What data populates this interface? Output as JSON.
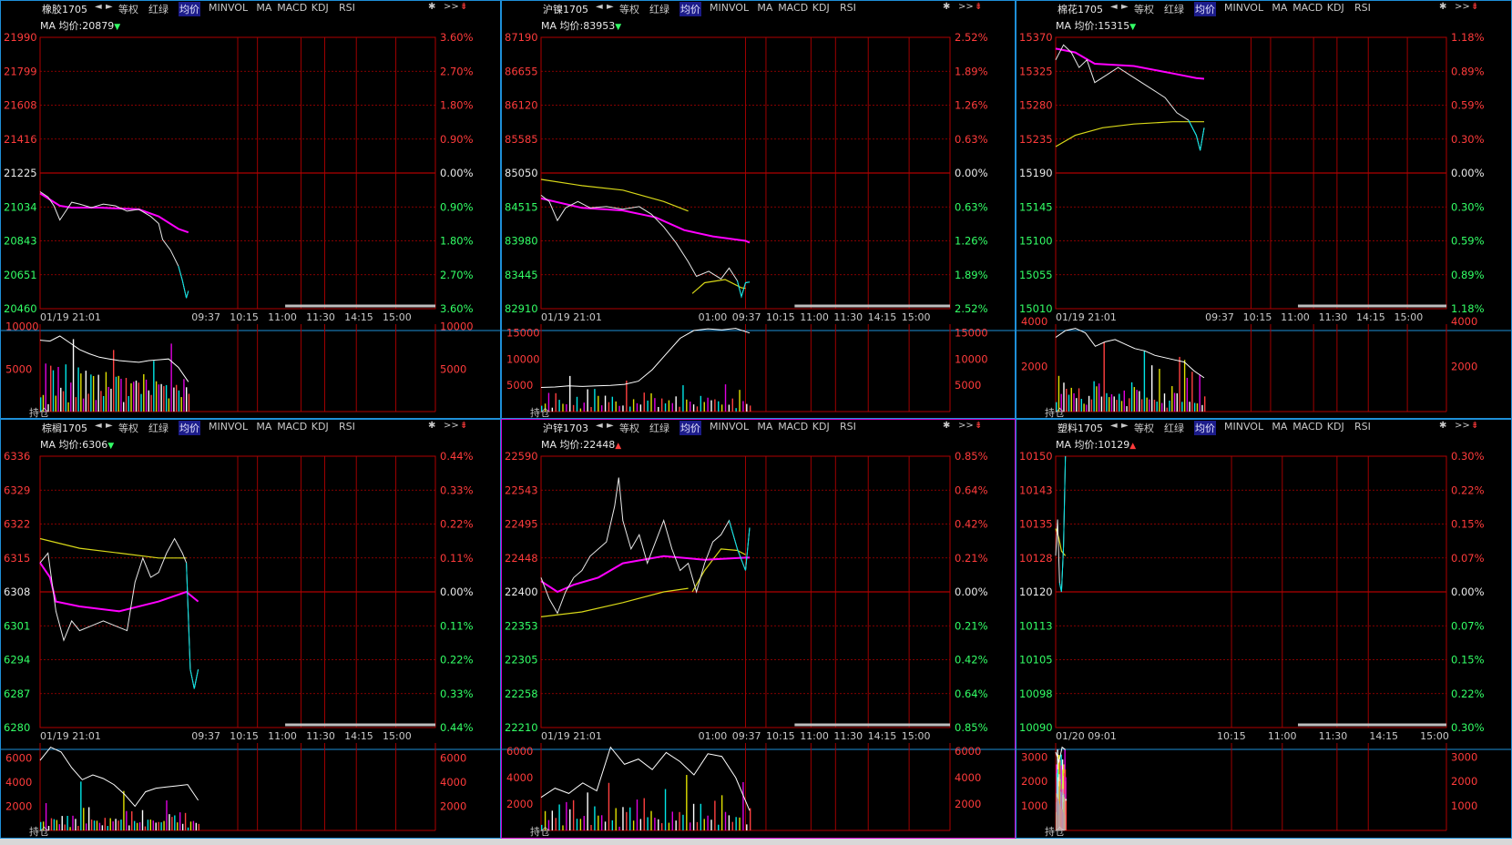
{
  "toolbar": {
    "nav_left": "◄",
    "nav_right": "►",
    "tabs": [
      "等权",
      "红绿",
      "均价",
      "MINVOL",
      "MA",
      "MACD",
      "KDJ",
      "RSI"
    ],
    "active_tab": "均价",
    "gear_icon": "gear-icon",
    "more_label": ">>",
    "pin_icon": "pin-icon"
  },
  "volume_label": "持仓",
  "colors": {
    "price": "#e8e8e8",
    "avg_price_magenta": "#ff00ff",
    "avg_line_yellow": "#d8d818",
    "grid": "#b00000",
    "axis_red": "#ff3b3b",
    "axis_green": "#33ff66",
    "axis_neutral": "#e8e8e8",
    "panel_border": "#1e8fd8",
    "panel_border_active": "#d000d0",
    "vol_cyan": "#00e5e5",
    "vol_yellow": "#e0e000",
    "vol_magenta": "#e000e0"
  },
  "chart_data": [
    {
      "type": "line",
      "symbol": "橡胶1705",
      "ma_label": "MA 均价:20879",
      "ma_dir": "down",
      "y_ticks": [
        "21990",
        "21799",
        "21608",
        "21416",
        "21225",
        "21034",
        "20843",
        "20651",
        "20460"
      ],
      "pct_ticks": [
        "3.60%",
        "2.70%",
        "1.80%",
        "0.90%",
        "0.00%",
        "0.90%",
        "1.80%",
        "2.70%",
        "3.60%"
      ],
      "x_ticks": [
        "01/19 21:01",
        "09:37",
        "10:15",
        "11:00",
        "11:30",
        "14:15",
        "15:00"
      ],
      "vol_ticks": [
        "10000",
        "5000"
      ],
      "ylim": [
        20460,
        21990
      ],
      "prev_close": 21225,
      "price": [
        [
          0,
          21120
        ],
        [
          0.02,
          21090
        ],
        [
          0.035,
          21040
        ],
        [
          0.05,
          20960
        ],
        [
          0.065,
          21010
        ],
        [
          0.08,
          21060
        ],
        [
          0.1,
          21050
        ],
        [
          0.13,
          21030
        ],
        [
          0.16,
          21050
        ],
        [
          0.19,
          21040
        ],
        [
          0.22,
          21010
        ],
        [
          0.25,
          21020
        ],
        [
          0.28,
          20980
        ],
        [
          0.3,
          20940
        ],
        [
          0.31,
          20850
        ],
        [
          0.33,
          20790
        ],
        [
          0.35,
          20700
        ],
        [
          0.36,
          20620
        ],
        [
          0.37,
          20520
        ],
        [
          0.375,
          20560
        ]
      ],
      "avg_magenta": [
        [
          0,
          21110
        ],
        [
          0.05,
          21040
        ],
        [
          0.08,
          21030
        ],
        [
          0.15,
          21030
        ],
        [
          0.25,
          21020
        ],
        [
          0.3,
          20980
        ],
        [
          0.35,
          20910
        ],
        [
          0.375,
          20890
        ]
      ],
      "volume": [
        4800,
        3200,
        6500,
        2100,
        8000,
        5200,
        3900,
        7100,
        2800,
        4400,
        6900,
        3100,
        5600,
        9800,
        4100,
        7700
      ],
      "oi_line": [
        8400,
        8300,
        8900,
        8100,
        7300,
        6800,
        6400,
        6200,
        6000,
        5900,
        5800,
        6000,
        6100,
        6200,
        5200,
        3500
      ]
    },
    {
      "type": "line",
      "symbol": "沪镍1705",
      "ma_label": "MA 均价:83953",
      "ma_dir": "down",
      "y_ticks": [
        "87190",
        "86655",
        "86120",
        "85585",
        "85050",
        "84515",
        "83980",
        "83445",
        "82910"
      ],
      "pct_ticks": [
        "2.52%",
        "1.89%",
        "1.26%",
        "0.63%",
        "0.00%",
        "0.63%",
        "1.26%",
        "1.89%",
        "2.52%"
      ],
      "x_ticks": [
        "01/19 21:01",
        "01:00",
        "09:37",
        "10:15",
        "11:00",
        "11:30",
        "14:15",
        "15:00"
      ],
      "vol_ticks": [
        "15000",
        "10000",
        "5000"
      ],
      "ylim": [
        82910,
        87190
      ],
      "prev_close": 85050,
      "price": [
        [
          0,
          84700
        ],
        [
          0.02,
          84600
        ],
        [
          0.04,
          84300
        ],
        [
          0.06,
          84500
        ],
        [
          0.09,
          84600
        ],
        [
          0.12,
          84500
        ],
        [
          0.16,
          84520
        ],
        [
          0.2,
          84480
        ],
        [
          0.24,
          84520
        ],
        [
          0.27,
          84400
        ],
        [
          0.3,
          84200
        ],
        [
          0.33,
          83950
        ],
        [
          0.36,
          83650
        ],
        [
          0.38,
          83420
        ],
        [
          0.41,
          83500
        ],
        [
          0.44,
          83380
        ],
        [
          0.46,
          83550
        ],
        [
          0.48,
          83350
        ],
        [
          0.49,
          83100
        ],
        [
          0.5,
          83320
        ],
        [
          0.51,
          83330
        ]
      ],
      "avg_magenta": [
        [
          0,
          84650
        ],
        [
          0.1,
          84500
        ],
        [
          0.2,
          84460
        ],
        [
          0.28,
          84350
        ],
        [
          0.35,
          84150
        ],
        [
          0.42,
          84050
        ],
        [
          0.5,
          83980
        ],
        [
          0.51,
          83953
        ]
      ],
      "avg_yellow": [
        [
          0,
          84950
        ],
        [
          0.1,
          84850
        ],
        [
          0.2,
          84780
        ],
        [
          0.3,
          84600
        ],
        [
          0.36,
          84450
        ]
      ],
      "avg_yellow2": [
        [
          0.37,
          83150
        ],
        [
          0.4,
          83320
        ],
        [
          0.45,
          83370
        ],
        [
          0.49,
          83240
        ],
        [
          0.5,
          83230
        ]
      ],
      "volume": [
        3200,
        2500,
        4100,
        1800,
        5200,
        2400,
        3100,
        1900,
        6800,
        2300,
        3500,
        1700,
        2800,
        4900,
        2100,
        6400
      ],
      "oi_line": [
        4600,
        4700,
        4900,
        4800,
        4900,
        5000,
        5200,
        5800,
        8000,
        11000,
        14000,
        15500,
        15800,
        15600,
        15900,
        15000
      ]
    },
    {
      "type": "line",
      "symbol": "棉花1705",
      "ma_label": "MA 均价:15315",
      "ma_dir": "down",
      "y_ticks": [
        "15370",
        "15325",
        "15280",
        "15235",
        "15190",
        "15145",
        "15100",
        "15055",
        "15010"
      ],
      "pct_ticks": [
        "1.18%",
        "0.89%",
        "0.59%",
        "0.30%",
        "0.00%",
        "0.30%",
        "0.59%",
        "0.89%",
        "1.18%"
      ],
      "x_ticks": [
        "01/19 21:01",
        "09:37",
        "10:15",
        "11:00",
        "11:30",
        "14:15",
        "15:00"
      ],
      "vol_ticks": [
        "4000",
        "2000"
      ],
      "ylim": [
        15010,
        15370
      ],
      "prev_close": 15190,
      "price": [
        [
          0,
          15340
        ],
        [
          0.02,
          15360
        ],
        [
          0.04,
          15350
        ],
        [
          0.06,
          15330
        ],
        [
          0.08,
          15340
        ],
        [
          0.1,
          15310
        ],
        [
          0.13,
          15320
        ],
        [
          0.16,
          15330
        ],
        [
          0.19,
          15320
        ],
        [
          0.22,
          15310
        ],
        [
          0.25,
          15300
        ],
        [
          0.28,
          15290
        ],
        [
          0.31,
          15270
        ],
        [
          0.34,
          15260
        ],
        [
          0.36,
          15240
        ],
        [
          0.37,
          15220
        ],
        [
          0.38,
          15250
        ]
      ],
      "avg_magenta": [
        [
          0,
          15355
        ],
        [
          0.05,
          15350
        ],
        [
          0.1,
          15335
        ],
        [
          0.2,
          15332
        ],
        [
          0.3,
          15322
        ],
        [
          0.36,
          15316
        ],
        [
          0.38,
          15315
        ]
      ],
      "avg_yellow": [
        [
          0,
          15225
        ],
        [
          0.05,
          15240
        ],
        [
          0.12,
          15250
        ],
        [
          0.2,
          15255
        ],
        [
          0.3,
          15258
        ],
        [
          0.38,
          15258
        ]
      ],
      "volume": [
        1200,
        2600,
        900,
        3100,
        1500,
        800,
        2200,
        1100,
        600,
        1900,
        700,
        1000,
        500,
        800,
        1300,
        2000
      ],
      "oi_line": [
        3300,
        3600,
        3700,
        3500,
        2900,
        3100,
        3200,
        3000,
        2800,
        2700,
        2500,
        2400,
        2300,
        2200,
        1800,
        1500
      ]
    },
    {
      "type": "line",
      "symbol": "棕榈1705",
      "ma_label": "MA 均价:6306",
      "ma_dir": "down",
      "y_ticks": [
        "6336",
        "6329",
        "6322",
        "6315",
        "6308",
        "6301",
        "6294",
        "6287",
        "6280"
      ],
      "pct_ticks": [
        "0.44%",
        "0.33%",
        "0.22%",
        "0.11%",
        "0.00%",
        "0.11%",
        "0.22%",
        "0.33%",
        "0.44%"
      ],
      "x_ticks": [
        "01/19 21:01",
        "09:37",
        "10:15",
        "11:00",
        "11:30",
        "14:15",
        "15:00"
      ],
      "vol_ticks": [
        "6000",
        "4000",
        "2000"
      ],
      "ylim": [
        6280,
        6336
      ],
      "prev_close": 6308,
      "price": [
        [
          0,
          6314
        ],
        [
          0.02,
          6316
        ],
        [
          0.04,
          6304
        ],
        [
          0.06,
          6298
        ],
        [
          0.08,
          6302
        ],
        [
          0.1,
          6300
        ],
        [
          0.13,
          6301
        ],
        [
          0.16,
          6302
        ],
        [
          0.19,
          6301
        ],
        [
          0.22,
          6300
        ],
        [
          0.24,
          6310
        ],
        [
          0.26,
          6315
        ],
        [
          0.28,
          6311
        ],
        [
          0.3,
          6312
        ],
        [
          0.32,
          6316
        ],
        [
          0.34,
          6319
        ],
        [
          0.36,
          6316
        ],
        [
          0.37,
          6314
        ],
        [
          0.38,
          6292
        ],
        [
          0.39,
          6288
        ],
        [
          0.4,
          6292
        ]
      ],
      "avg_magenta": [
        [
          0,
          6314
        ],
        [
          0.025,
          6311
        ],
        [
          0.04,
          6306
        ],
        [
          0.1,
          6305
        ],
        [
          0.2,
          6304
        ],
        [
          0.3,
          6306
        ],
        [
          0.37,
          6308
        ],
        [
          0.4,
          6306
        ]
      ],
      "avg_yellow": [
        [
          0,
          6319
        ],
        [
          0.1,
          6317
        ],
        [
          0.2,
          6316
        ],
        [
          0.3,
          6315
        ],
        [
          0.37,
          6315
        ]
      ],
      "volume": [
        2000,
        1200,
        2600,
        900,
        1500,
        1000,
        1800,
        700,
        1200,
        900,
        1500,
        800,
        2000,
        1100,
        900,
        6000
      ],
      "oi_line": [
        5800,
        6900,
        6500,
        5200,
        4200,
        4600,
        4300,
        3800,
        3000,
        2000,
        3200,
        3500,
        3600,
        3700,
        3800,
        2500
      ]
    },
    {
      "type": "line",
      "symbol": "沪锌1703",
      "ma_label": "MA 均价:22448",
      "ma_dir": "up",
      "y_ticks": [
        "22590",
        "22543",
        "22495",
        "22448",
        "22400",
        "22353",
        "22305",
        "22258",
        "22210"
      ],
      "pct_ticks": [
        "0.85%",
        "0.64%",
        "0.42%",
        "0.21%",
        "0.00%",
        "0.21%",
        "0.42%",
        "0.64%",
        "0.85%"
      ],
      "x_ticks": [
        "01/19 21:01",
        "01:00",
        "09:37",
        "10:15",
        "11:00",
        "11:30",
        "14:15",
        "15:00"
      ],
      "vol_ticks": [
        "6000",
        "4000",
        "2000"
      ],
      "ylim": [
        22210,
        22590
      ],
      "prev_close": 22400,
      "price": [
        [
          0,
          22420
        ],
        [
          0.02,
          22390
        ],
        [
          0.04,
          22370
        ],
        [
          0.06,
          22400
        ],
        [
          0.08,
          22420
        ],
        [
          0.1,
          22430
        ],
        [
          0.12,
          22450
        ],
        [
          0.14,
          22460
        ],
        [
          0.16,
          22470
        ],
        [
          0.18,
          22520
        ],
        [
          0.19,
          22560
        ],
        [
          0.2,
          22500
        ],
        [
          0.22,
          22460
        ],
        [
          0.24,
          22480
        ],
        [
          0.26,
          22440
        ],
        [
          0.28,
          22470
        ],
        [
          0.3,
          22500
        ],
        [
          0.32,
          22460
        ],
        [
          0.34,
          22430
        ],
        [
          0.36,
          22440
        ],
        [
          0.38,
          22400
        ],
        [
          0.4,
          22440
        ],
        [
          0.42,
          22470
        ],
        [
          0.44,
          22480
        ],
        [
          0.46,
          22500
        ],
        [
          0.48,
          22460
        ],
        [
          0.5,
          22430
        ],
        [
          0.51,
          22490
        ]
      ],
      "avg_magenta": [
        [
          0,
          22415
        ],
        [
          0.04,
          22400
        ],
        [
          0.08,
          22410
        ],
        [
          0.14,
          22420
        ],
        [
          0.2,
          22440
        ],
        [
          0.3,
          22450
        ],
        [
          0.4,
          22445
        ],
        [
          0.5,
          22448
        ],
        [
          0.51,
          22448
        ]
      ],
      "avg_yellow": [
        [
          0,
          22365
        ],
        [
          0.1,
          22372
        ],
        [
          0.2,
          22385
        ],
        [
          0.3,
          22400
        ],
        [
          0.36,
          22405
        ]
      ],
      "avg_yellow2": [
        [
          0.37,
          22400
        ],
        [
          0.4,
          22430
        ],
        [
          0.44,
          22460
        ],
        [
          0.48,
          22458
        ],
        [
          0.5,
          22452
        ]
      ],
      "volume": [
        1200,
        2400,
        900,
        3600,
        1400,
        2100,
        800,
        2900,
        1600,
        4200,
        1100,
        2500,
        1800,
        3300,
        1000,
        2700
      ],
      "oi_line": [
        2500,
        3200,
        2800,
        3600,
        3000,
        6300,
        5000,
        5400,
        4600,
        5900,
        5200,
        4200,
        5800,
        5600,
        4000,
        1500
      ]
    },
    {
      "type": "line",
      "symbol": "塑料1705",
      "ma_label": "MA 均价:10129",
      "ma_dir": "up",
      "y_ticks": [
        "10150",
        "10143",
        "10135",
        "10128",
        "10120",
        "10113",
        "10105",
        "10098",
        "10090"
      ],
      "pct_ticks": [
        "0.30%",
        "0.22%",
        "0.15%",
        "0.07%",
        "0.00%",
        "0.07%",
        "0.15%",
        "0.22%",
        "0.30%"
      ],
      "x_ticks": [
        "01/20 09:01",
        "10:15",
        "11:00",
        "11:30",
        "14:15",
        "15:00"
      ],
      "vol_ticks": [
        "3000",
        "2000",
        "1000"
      ],
      "ylim": [
        10090,
        10150
      ],
      "prev_close": 10120,
      "price": [
        [
          0,
          10128
        ],
        [
          0.005,
          10136
        ],
        [
          0.01,
          10122
        ],
        [
          0.015,
          10120
        ],
        [
          0.02,
          10130
        ],
        [
          0.025,
          10150
        ]
      ],
      "avg_yellow": [
        [
          0,
          10134
        ],
        [
          0.008,
          10132
        ],
        [
          0.015,
          10129
        ],
        [
          0.025,
          10128
        ]
      ],
      "volume": [
        3300,
        2500,
        3100,
        1800
      ],
      "oi_line": [
        3200,
        2800,
        3400,
        3300
      ]
    }
  ]
}
